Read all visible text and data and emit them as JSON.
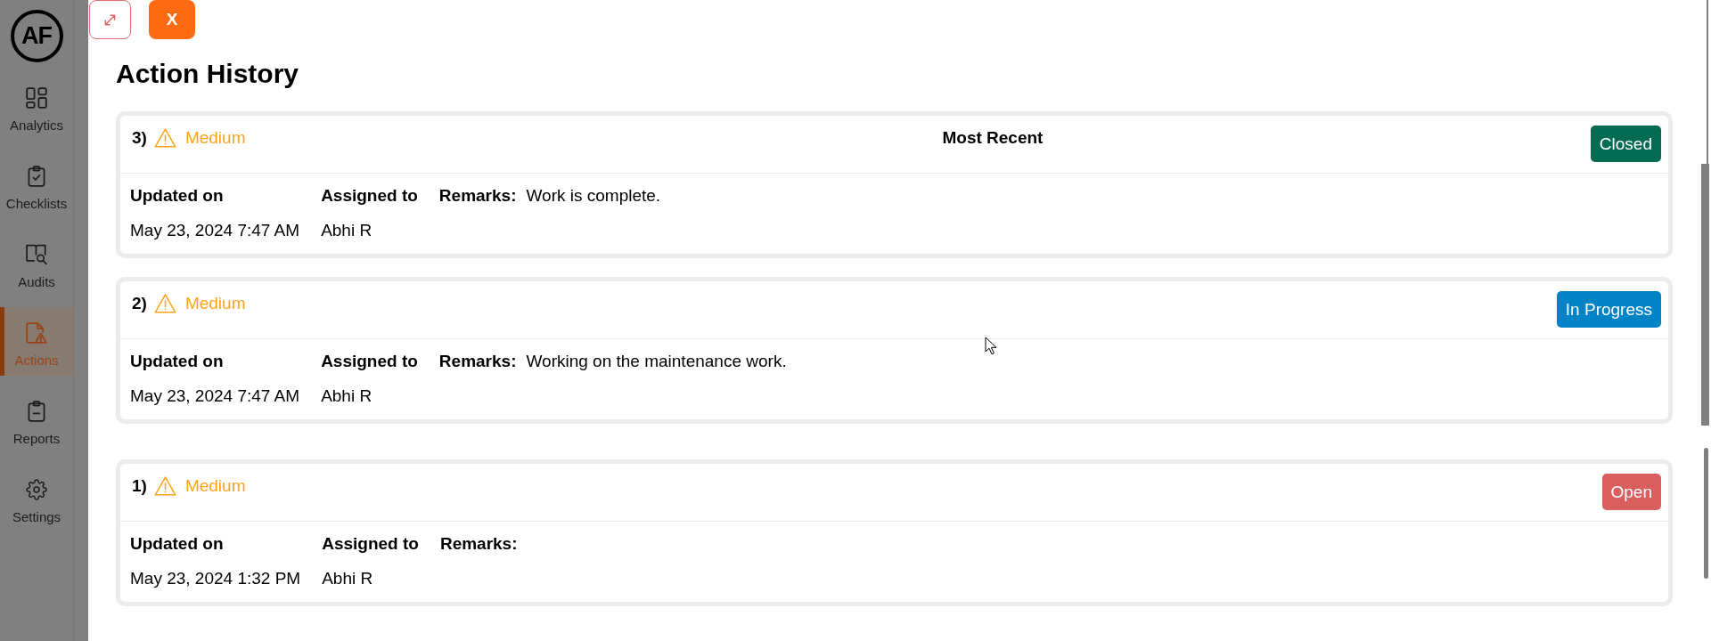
{
  "sidebar": {
    "logo": "AF",
    "items": [
      {
        "label": "Analytics",
        "selected": false
      },
      {
        "label": "Checklists",
        "selected": false
      },
      {
        "label": "Audits",
        "selected": false
      },
      {
        "label": "Actions",
        "selected": true
      },
      {
        "label": "Reports",
        "selected": false
      },
      {
        "label": "Settings",
        "selected": false
      }
    ]
  },
  "close_button": {
    "label": "X"
  },
  "title": "Action History",
  "history": [
    {
      "number": "3)",
      "priority": "Medium",
      "tag": "Most Recent",
      "status": {
        "label": "Closed",
        "color": "#036b52"
      },
      "fields": [
        {
          "kind": "stacked",
          "label": "Updated on",
          "value": "May 23, 2024 7:47 AM"
        },
        {
          "kind": "stacked",
          "label": "Assigned to",
          "value": "Abhi R"
        },
        {
          "kind": "inline",
          "label": "Remarks:",
          "value": "Work is complete."
        }
      ]
    },
    {
      "number": "2)",
      "priority": "Medium",
      "status": {
        "label": "In Progress",
        "color": "#0283c6"
      },
      "fields": [
        {
          "kind": "stacked",
          "label": "Updated on",
          "value": "May 23, 2024 7:47 AM"
        },
        {
          "kind": "stacked",
          "label": "Assigned to",
          "value": "Abhi R"
        },
        {
          "kind": "inline",
          "label": "Remarks:",
          "value": "Working on the maintenance work."
        }
      ]
    },
    {
      "number": "1)",
      "priority": "Medium",
      "status": {
        "label": "Open",
        "color": "#d95f5f"
      },
      "fields": [
        {
          "kind": "stacked",
          "label": "Updated on",
          "value": "May 23, 2024 1:32 PM"
        },
        {
          "kind": "stacked",
          "label": "Assigned to",
          "value": "Abhi R"
        },
        {
          "kind": "inline",
          "label": "Remarks:"
        }
      ]
    }
  ]
}
